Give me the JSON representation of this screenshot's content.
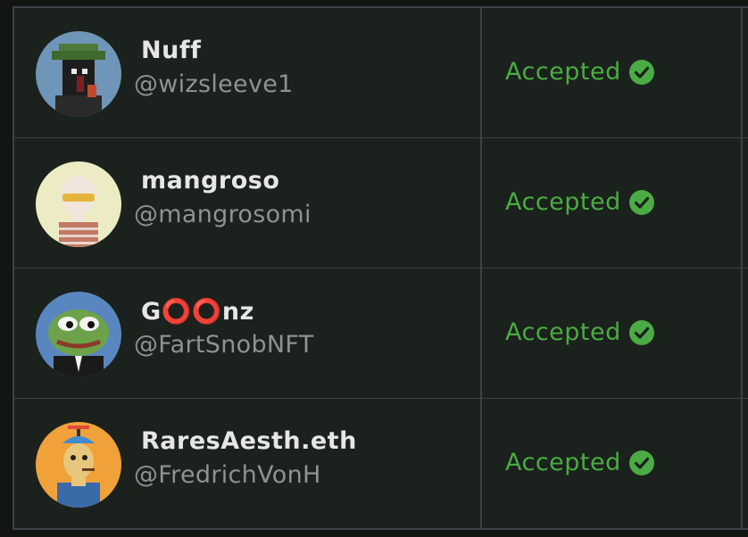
{
  "colors": {
    "accepted": "#4bab44",
    "name": "#e6e6e6",
    "handle": "#8d9296",
    "row_bg": "#1b211c",
    "border": "#3c4247"
  },
  "rows": [
    {
      "name_parts": [
        "Nuff",
        "",
        ""
      ],
      "handle": "@wizsleeve1",
      "status": "Accepted",
      "avatar_icon": "pixel-punk-avatar",
      "status_icon": "check-circle-icon"
    },
    {
      "name_parts": [
        "mangroso",
        "",
        ""
      ],
      "handle": "@mangrosomi",
      "status": "Accepted",
      "avatar_icon": "bald-character-avatar",
      "status_icon": "check-circle-icon"
    },
    {
      "name_parts": [
        "G",
        "⭕⭕",
        "nz"
      ],
      "handle": "@FartSnobNFT",
      "status": "Accepted",
      "avatar_icon": "pepe-frog-avatar",
      "status_icon": "check-circle-icon"
    },
    {
      "name_parts": [
        "RaresAesth.eth",
        "",
        ""
      ],
      "handle": "@FredrichVonH",
      "status": "Accepted",
      "avatar_icon": "propeller-hat-avatar",
      "status_icon": "check-circle-icon"
    }
  ]
}
